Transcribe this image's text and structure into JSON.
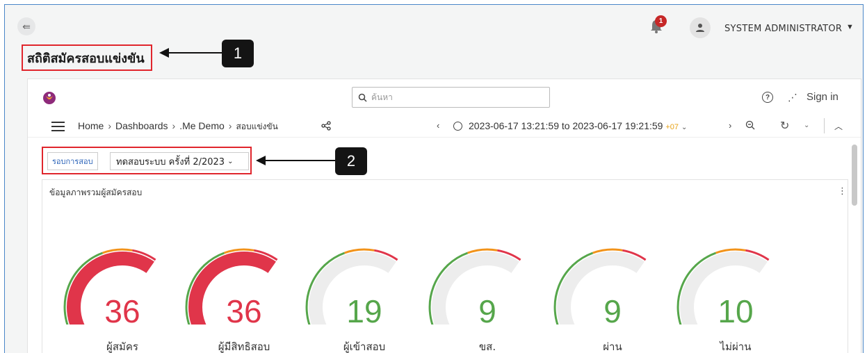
{
  "topbar": {
    "collapse_icon": "collapse-left-icon",
    "notification_count": "1",
    "user_name": "SYSTEM ADMINISTRATOR"
  },
  "page": {
    "title": "สถิติสมัครสอบแข่งขัน"
  },
  "callouts": [
    "1",
    "2"
  ],
  "dashboard": {
    "search_placeholder": "ค้นหา",
    "help": "?",
    "sign_in": "Sign in",
    "breadcrumb": [
      "Home",
      "Dashboards",
      ".Me Demo",
      "สอบแข่งขัน"
    ],
    "time_range": "2023-06-17 13:21:59 to 2023-06-17 19:21:59",
    "timezone": "+07",
    "filter": {
      "label": "รอบการสอบ",
      "selected": "ทดสอบระบบ ครั้งที่ 2/2023"
    },
    "panel_title": "ข้อมูลภาพรวมผู้สมัครสอบ"
  },
  "colors": {
    "red": "#e0354a",
    "green": "#56a64b",
    "orange": "#f2931a",
    "track": "#ededed"
  },
  "gauges": [
    {
      "value": 36,
      "label": "ผู้สมัคร",
      "fill": 1.0,
      "color": "#e0354a"
    },
    {
      "value": 36,
      "label": "ผู้มีสิทธิสอบ",
      "fill": 1.0,
      "color": "#e0354a"
    },
    {
      "value": 19,
      "label": "ผู้เข้าสอบ",
      "fill": 0.24,
      "color": "#56a64b"
    },
    {
      "value": 9,
      "label": "ขส.",
      "fill": 0.0,
      "color": "#56a64b"
    },
    {
      "value": 9,
      "label": "ผ่าน",
      "fill": 0.0,
      "color": "#56a64b"
    },
    {
      "value": 10,
      "label": "ไม่ผ่าน",
      "fill": 0.02,
      "color": "#56a64b"
    }
  ]
}
